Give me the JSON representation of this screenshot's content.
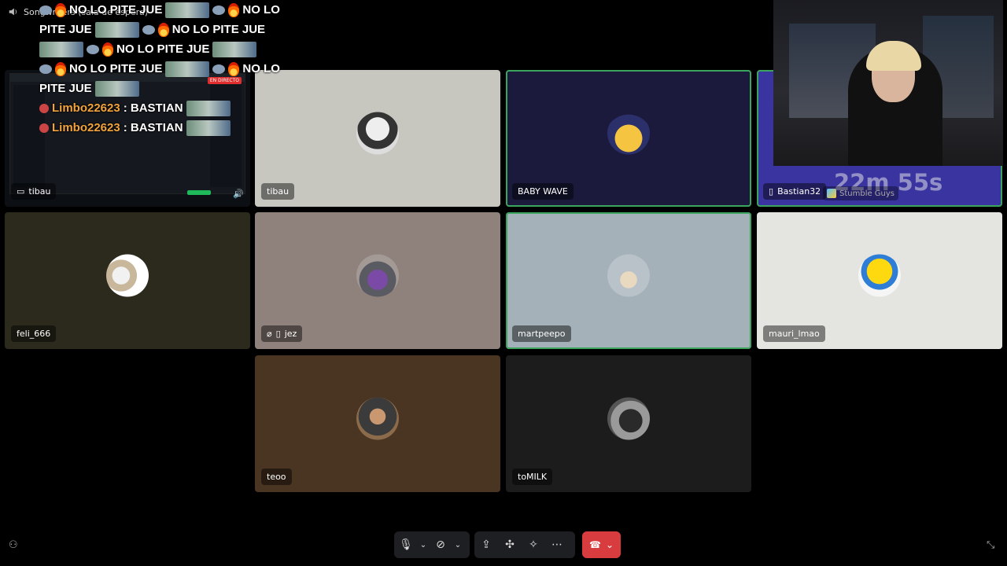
{
  "top_status": {
    "label": "Songwriters (sala de espera)"
  },
  "chat_overlay": {
    "lines": [
      {
        "text": "NO LO"
      },
      {
        "text": "PITE JUE"
      },
      {
        "text": "NO LO PITE JUE"
      },
      {
        "text": "NO LO PITE JUE"
      },
      {
        "text": "NO LO"
      },
      {
        "text": "PITE JUE"
      }
    ],
    "messages": [
      {
        "user": "Limbo22623",
        "text": ": BASTIAN"
      },
      {
        "user": "Limbo22623",
        "text": ": BASTIAN"
      }
    ]
  },
  "participants": [
    {
      "name": "tibau",
      "bg": "#0c0f14"
    },
    {
      "name": "tibau",
      "bg": "#c7c7c0"
    },
    {
      "name": "BABY WAVE",
      "bg": "#1b1a3c"
    },
    {
      "name": "Bastian32",
      "bg": "#3a34a0"
    },
    {
      "name": "feli_666",
      "bg": "#2b2a1c"
    },
    {
      "name": "jez",
      "bg": "#8f817c"
    },
    {
      "name": "martpeepo",
      "bg": "#a4b1b8"
    },
    {
      "name": "mauri_lmao",
      "bg": "#e4e4e0"
    },
    {
      "name": "teoo",
      "bg": "#4a3422"
    },
    {
      "name": "toMILK",
      "bg": "#1c1c1d"
    }
  ],
  "stream": {
    "timer": "22m 55s",
    "game": "Stumble Guys"
  },
  "controls": {
    "accent_hangup": "#d83c3e",
    "icons": [
      "microphone-icon",
      "chevron-down-icon",
      "camera-off-icon",
      "chevron-down-icon",
      "screen-share-icon",
      "activities-icon",
      "soundboard-icon",
      "more-icon"
    ]
  }
}
